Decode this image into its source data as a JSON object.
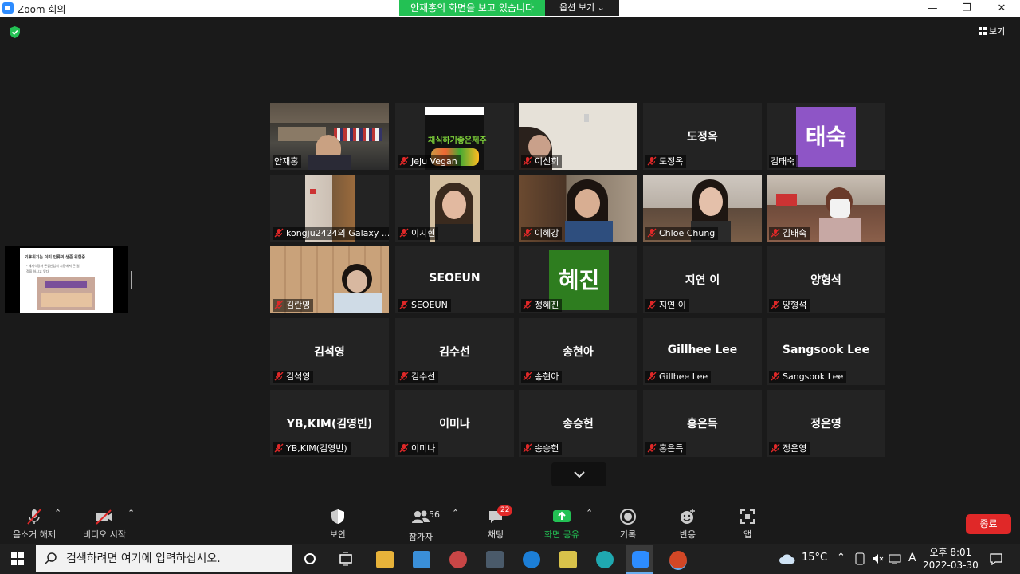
{
  "window": {
    "title": "Zoom 회의",
    "minimize": "—",
    "restore": "❐",
    "close": "✕"
  },
  "share_banner": {
    "text": "안재홍의 화면을 보고 있습니다",
    "view_options": "옵션 보기 ⌄"
  },
  "view_button": {
    "label": "보기"
  },
  "shared_slide": {
    "title": "기후위기는 이미 인류의 생존 위협중",
    "line1": "- 세계식량과 존엄산업의 시장에서 큰 일",
    "line2": "정을 하시고 있다"
  },
  "participants": [
    {
      "name": "안재홍",
      "display": "",
      "kind": "video",
      "active": true
    },
    {
      "name": "Jeju Vegan",
      "display": "",
      "kind": "video",
      "active": false
    },
    {
      "name": "이신희",
      "display": "",
      "kind": "video",
      "active": false
    },
    {
      "name": "도정옥",
      "display": "도정옥",
      "kind": "name",
      "active": false
    },
    {
      "name": "김태숙",
      "display": "태숙",
      "kind": "avatar",
      "avatar_color": "#8e55c6",
      "active": false
    },
    {
      "name": "kongju2424의 Galaxy ...",
      "display": "",
      "kind": "video",
      "active": false
    },
    {
      "name": "이지현",
      "display": "",
      "kind": "video",
      "active": false
    },
    {
      "name": "이혜강",
      "display": "",
      "kind": "video",
      "active": false
    },
    {
      "name": "Chloe Chung",
      "display": "",
      "kind": "video",
      "active": false
    },
    {
      "name": "김태숙",
      "display": "",
      "kind": "video",
      "active": false
    },
    {
      "name": "김란영",
      "display": "",
      "kind": "video",
      "active": false
    },
    {
      "name": "SEOEUN",
      "display": "SEOEUN",
      "kind": "name",
      "active": false
    },
    {
      "name": "정혜진",
      "display": "혜진",
      "kind": "avatar",
      "avatar_color": "#2e7d1f",
      "active": false
    },
    {
      "name": "지연 이",
      "display": "지연 이",
      "kind": "name",
      "active": false
    },
    {
      "name": "양형석",
      "display": "양형석",
      "kind": "name",
      "active": false
    },
    {
      "name": "김석영",
      "display": "김석영",
      "kind": "name",
      "active": false
    },
    {
      "name": "김수선",
      "display": "김수선",
      "kind": "name",
      "active": false
    },
    {
      "name": "송현아",
      "display": "송현아",
      "kind": "name",
      "active": false
    },
    {
      "name": "Gillhee Lee",
      "display": "Gillhee Lee",
      "kind": "name",
      "active": false
    },
    {
      "name": "Sangsook Lee",
      "display": "Sangsook Lee",
      "kind": "name",
      "active": false
    },
    {
      "name": "YB,KIM(김영빈)",
      "display": "YB,KIM(김영빈)",
      "kind": "name",
      "active": false
    },
    {
      "name": "이미나",
      "display": "이미나",
      "kind": "name",
      "active": false
    },
    {
      "name": "송승헌",
      "display": "송승헌",
      "kind": "name",
      "active": false
    },
    {
      "name": "홍은득",
      "display": "홍은득",
      "kind": "name",
      "active": false
    },
    {
      "name": "정은영",
      "display": "정은영",
      "kind": "name",
      "active": false
    }
  ],
  "jeju_banner": "채식하기좋은제주",
  "toolbar": {
    "unmute": "음소거 해제",
    "start_video": "비디오 시작",
    "security": "보안",
    "participants": "참가자",
    "participants_count": "56",
    "chat": "채팅",
    "chat_badge": "22",
    "share_screen": "화면 공유",
    "record": "기록",
    "reactions": "반응",
    "apps": "앱",
    "end": "종료"
  },
  "taskbar": {
    "search_placeholder": "검색하려면 여기에 입력하십시오.",
    "weather": "15°C",
    "ime": "A",
    "time": "오후 8:01",
    "date": "2022-03-30"
  },
  "colors": {
    "accent_green": "#23c154",
    "end_red": "#e02828",
    "active_speaker": "#d9e84a",
    "tile_bg": "#232323"
  }
}
